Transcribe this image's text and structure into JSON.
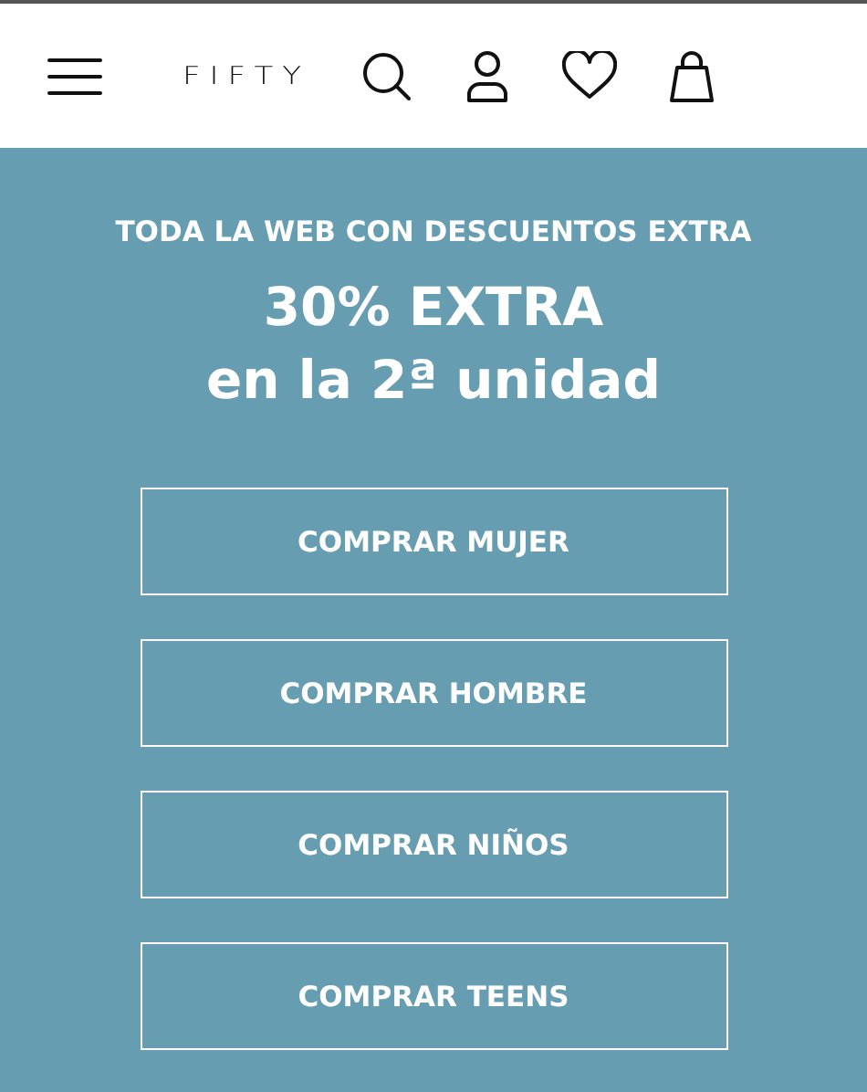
{
  "header": {
    "logo": "FIFTY"
  },
  "banner": {
    "subtitle": "TODA LA WEB CON DESCUENTOS EXTRA",
    "headline": [
      "30% EXTRA",
      "en la 2ª unidad"
    ],
    "buttons": [
      "COMPRAR MUJER",
      "COMPRAR HOMBRE",
      "COMPRAR NIÑOS",
      "COMPRAR TEENS"
    ]
  }
}
